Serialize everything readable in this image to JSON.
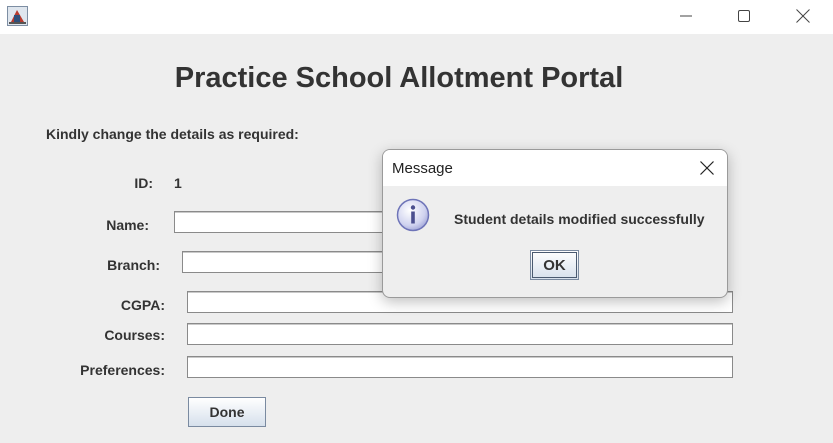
{
  "window": {
    "app_icon": "java-app-icon",
    "controls": {
      "minimize_icon": "minimize-icon",
      "maximize_icon": "maximize-icon",
      "close_icon": "close-icon"
    }
  },
  "form": {
    "heading": "Practice School Allotment Portal",
    "subheading": "Kindly change the details as required:",
    "id_label": "ID:",
    "id_value": "1",
    "name_label": "Name:",
    "branch_label": "Branch:",
    "cgpa_label": "CGPA:",
    "courses_label": "Courses:",
    "preferences_label": "Preferences:",
    "name_value": "",
    "branch_value": "",
    "cgpa_value": "",
    "courses_value": "",
    "preferences_value": "",
    "done_label": "Done"
  },
  "dialog": {
    "title": "Message",
    "message": "Student details modified successfully",
    "ok_label": "OK",
    "icon": "info-icon"
  }
}
